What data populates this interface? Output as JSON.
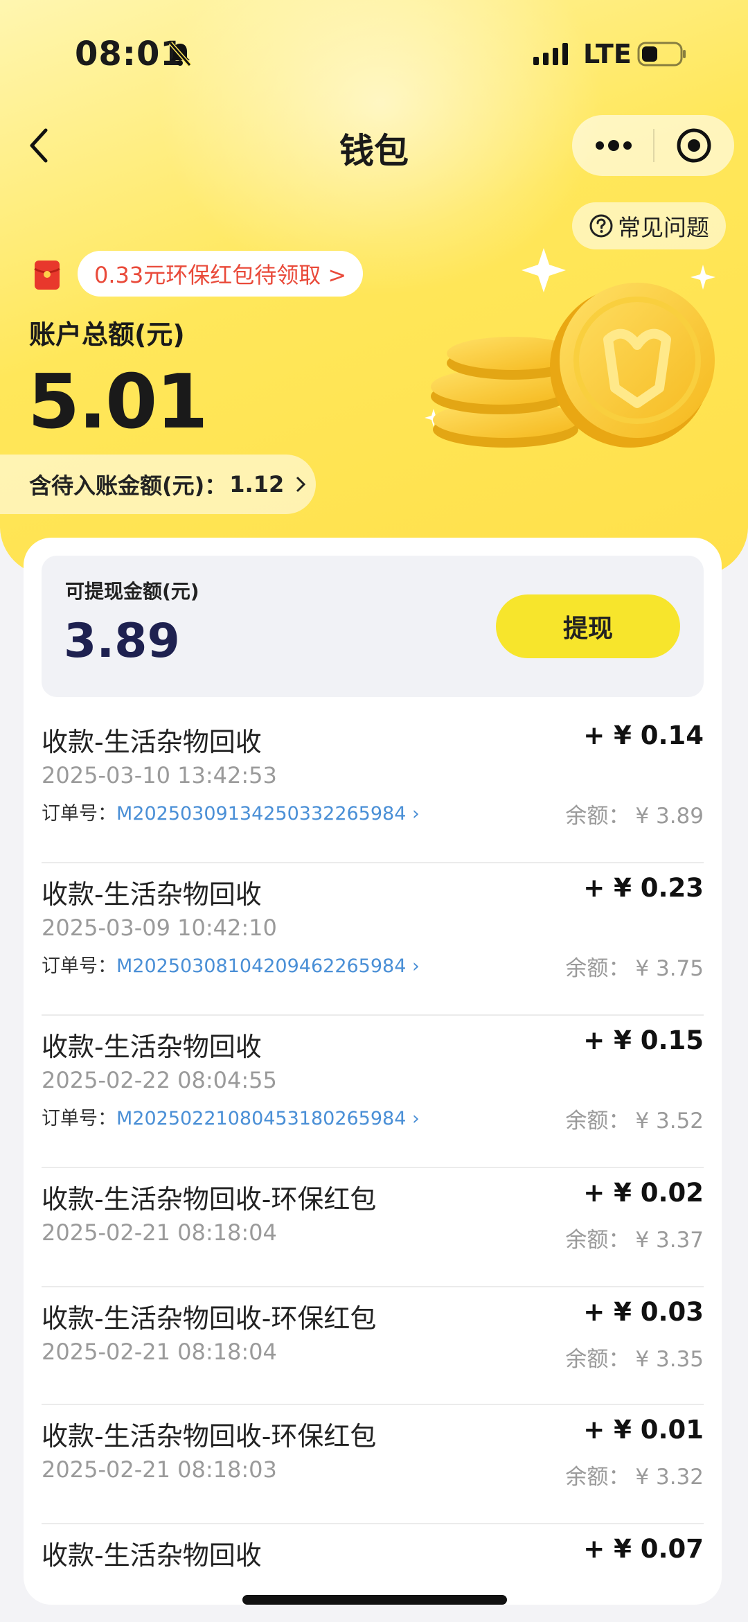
{
  "status_bar": {
    "time": "08:01",
    "network": "LTE"
  },
  "nav": {
    "title": "钱包"
  },
  "faq_label": "常见问题",
  "red_packet_banner": "0.33元环保红包待领取 >",
  "total": {
    "label": "账户总额(元)",
    "value": "5.01"
  },
  "pending": {
    "label": "含待入账金额(元)：",
    "value": "1.12"
  },
  "withdraw": {
    "label": "可提现金额(元)",
    "value": "3.89",
    "button": "提现"
  },
  "order_prefix": "订单号：",
  "balance_prefix": "余额：",
  "transactions": [
    {
      "title": "收款-生活杂物回收",
      "amount": "+ ¥ 0.14",
      "time": "2025-03-10 13:42:53",
      "order": "M20250309134250332265984 ›",
      "balance": "¥ 3.89"
    },
    {
      "title": "收款-生活杂物回收",
      "amount": "+ ¥ 0.23",
      "time": "2025-03-09 10:42:10",
      "order": "M20250308104209462265984 ›",
      "balance": "¥ 3.75"
    },
    {
      "title": "收款-生活杂物回收",
      "amount": "+ ¥ 0.15",
      "time": "2025-02-22 08:04:55",
      "order": "M20250221080453180265984 ›",
      "balance": "¥ 3.52"
    },
    {
      "title": "收款-生活杂物回收-环保红包",
      "amount": "+ ¥ 0.02",
      "time": "2025-02-21 08:18:04",
      "balance": "¥ 3.37"
    },
    {
      "title": "收款-生活杂物回收-环保红包",
      "amount": "+ ¥ 0.03",
      "time": "2025-02-21 08:18:04",
      "balance": "¥ 3.35"
    },
    {
      "title": "收款-生活杂物回收-环保红包",
      "amount": "+ ¥ 0.01",
      "time": "2025-02-21 08:18:03",
      "balance": "¥ 3.32"
    },
    {
      "title": "收款-生活杂物回收",
      "amount": "+ ¥ 0.07"
    }
  ],
  "colors": {
    "accent_yellow": "#f7e52c",
    "link_blue": "#4a8fd6",
    "banner_red": "#e94a3a"
  }
}
